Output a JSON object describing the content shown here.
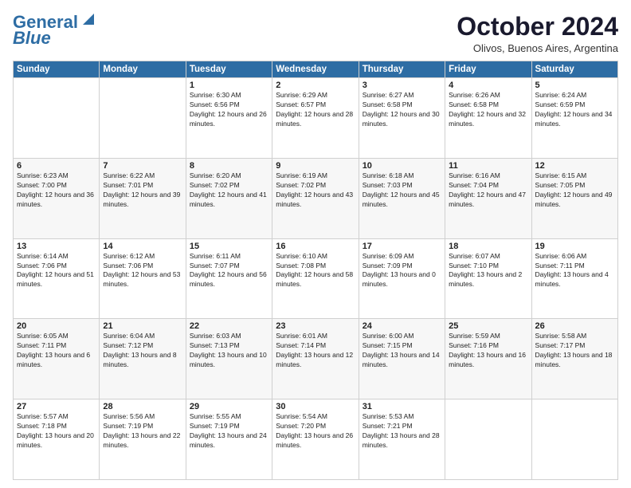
{
  "logo": {
    "line1": "General",
    "line2": "Blue"
  },
  "header": {
    "month": "October 2024",
    "location": "Olivos, Buenos Aires, Argentina"
  },
  "weekdays": [
    "Sunday",
    "Monday",
    "Tuesday",
    "Wednesday",
    "Thursday",
    "Friday",
    "Saturday"
  ],
  "weeks": [
    [
      {
        "day": "",
        "sunrise": "",
        "sunset": "",
        "daylight": ""
      },
      {
        "day": "",
        "sunrise": "",
        "sunset": "",
        "daylight": ""
      },
      {
        "day": "1",
        "sunrise": "Sunrise: 6:30 AM",
        "sunset": "Sunset: 6:56 PM",
        "daylight": "Daylight: 12 hours and 26 minutes."
      },
      {
        "day": "2",
        "sunrise": "Sunrise: 6:29 AM",
        "sunset": "Sunset: 6:57 PM",
        "daylight": "Daylight: 12 hours and 28 minutes."
      },
      {
        "day": "3",
        "sunrise": "Sunrise: 6:27 AM",
        "sunset": "Sunset: 6:58 PM",
        "daylight": "Daylight: 12 hours and 30 minutes."
      },
      {
        "day": "4",
        "sunrise": "Sunrise: 6:26 AM",
        "sunset": "Sunset: 6:58 PM",
        "daylight": "Daylight: 12 hours and 32 minutes."
      },
      {
        "day": "5",
        "sunrise": "Sunrise: 6:24 AM",
        "sunset": "Sunset: 6:59 PM",
        "daylight": "Daylight: 12 hours and 34 minutes."
      }
    ],
    [
      {
        "day": "6",
        "sunrise": "Sunrise: 6:23 AM",
        "sunset": "Sunset: 7:00 PM",
        "daylight": "Daylight: 12 hours and 36 minutes."
      },
      {
        "day": "7",
        "sunrise": "Sunrise: 6:22 AM",
        "sunset": "Sunset: 7:01 PM",
        "daylight": "Daylight: 12 hours and 39 minutes."
      },
      {
        "day": "8",
        "sunrise": "Sunrise: 6:20 AM",
        "sunset": "Sunset: 7:02 PM",
        "daylight": "Daylight: 12 hours and 41 minutes."
      },
      {
        "day": "9",
        "sunrise": "Sunrise: 6:19 AM",
        "sunset": "Sunset: 7:02 PM",
        "daylight": "Daylight: 12 hours and 43 minutes."
      },
      {
        "day": "10",
        "sunrise": "Sunrise: 6:18 AM",
        "sunset": "Sunset: 7:03 PM",
        "daylight": "Daylight: 12 hours and 45 minutes."
      },
      {
        "day": "11",
        "sunrise": "Sunrise: 6:16 AM",
        "sunset": "Sunset: 7:04 PM",
        "daylight": "Daylight: 12 hours and 47 minutes."
      },
      {
        "day": "12",
        "sunrise": "Sunrise: 6:15 AM",
        "sunset": "Sunset: 7:05 PM",
        "daylight": "Daylight: 12 hours and 49 minutes."
      }
    ],
    [
      {
        "day": "13",
        "sunrise": "Sunrise: 6:14 AM",
        "sunset": "Sunset: 7:06 PM",
        "daylight": "Daylight: 12 hours and 51 minutes."
      },
      {
        "day": "14",
        "sunrise": "Sunrise: 6:12 AM",
        "sunset": "Sunset: 7:06 PM",
        "daylight": "Daylight: 12 hours and 53 minutes."
      },
      {
        "day": "15",
        "sunrise": "Sunrise: 6:11 AM",
        "sunset": "Sunset: 7:07 PM",
        "daylight": "Daylight: 12 hours and 56 minutes."
      },
      {
        "day": "16",
        "sunrise": "Sunrise: 6:10 AM",
        "sunset": "Sunset: 7:08 PM",
        "daylight": "Daylight: 12 hours and 58 minutes."
      },
      {
        "day": "17",
        "sunrise": "Sunrise: 6:09 AM",
        "sunset": "Sunset: 7:09 PM",
        "daylight": "Daylight: 13 hours and 0 minutes."
      },
      {
        "day": "18",
        "sunrise": "Sunrise: 6:07 AM",
        "sunset": "Sunset: 7:10 PM",
        "daylight": "Daylight: 13 hours and 2 minutes."
      },
      {
        "day": "19",
        "sunrise": "Sunrise: 6:06 AM",
        "sunset": "Sunset: 7:11 PM",
        "daylight": "Daylight: 13 hours and 4 minutes."
      }
    ],
    [
      {
        "day": "20",
        "sunrise": "Sunrise: 6:05 AM",
        "sunset": "Sunset: 7:11 PM",
        "daylight": "Daylight: 13 hours and 6 minutes."
      },
      {
        "day": "21",
        "sunrise": "Sunrise: 6:04 AM",
        "sunset": "Sunset: 7:12 PM",
        "daylight": "Daylight: 13 hours and 8 minutes."
      },
      {
        "day": "22",
        "sunrise": "Sunrise: 6:03 AM",
        "sunset": "Sunset: 7:13 PM",
        "daylight": "Daylight: 13 hours and 10 minutes."
      },
      {
        "day": "23",
        "sunrise": "Sunrise: 6:01 AM",
        "sunset": "Sunset: 7:14 PM",
        "daylight": "Daylight: 13 hours and 12 minutes."
      },
      {
        "day": "24",
        "sunrise": "Sunrise: 6:00 AM",
        "sunset": "Sunset: 7:15 PM",
        "daylight": "Daylight: 13 hours and 14 minutes."
      },
      {
        "day": "25",
        "sunrise": "Sunrise: 5:59 AM",
        "sunset": "Sunset: 7:16 PM",
        "daylight": "Daylight: 13 hours and 16 minutes."
      },
      {
        "day": "26",
        "sunrise": "Sunrise: 5:58 AM",
        "sunset": "Sunset: 7:17 PM",
        "daylight": "Daylight: 13 hours and 18 minutes."
      }
    ],
    [
      {
        "day": "27",
        "sunrise": "Sunrise: 5:57 AM",
        "sunset": "Sunset: 7:18 PM",
        "daylight": "Daylight: 13 hours and 20 minutes."
      },
      {
        "day": "28",
        "sunrise": "Sunrise: 5:56 AM",
        "sunset": "Sunset: 7:19 PM",
        "daylight": "Daylight: 13 hours and 22 minutes."
      },
      {
        "day": "29",
        "sunrise": "Sunrise: 5:55 AM",
        "sunset": "Sunset: 7:19 PM",
        "daylight": "Daylight: 13 hours and 24 minutes."
      },
      {
        "day": "30",
        "sunrise": "Sunrise: 5:54 AM",
        "sunset": "Sunset: 7:20 PM",
        "daylight": "Daylight: 13 hours and 26 minutes."
      },
      {
        "day": "31",
        "sunrise": "Sunrise: 5:53 AM",
        "sunset": "Sunset: 7:21 PM",
        "daylight": "Daylight: 13 hours and 28 minutes."
      },
      {
        "day": "",
        "sunrise": "",
        "sunset": "",
        "daylight": ""
      },
      {
        "day": "",
        "sunrise": "",
        "sunset": "",
        "daylight": ""
      }
    ]
  ]
}
